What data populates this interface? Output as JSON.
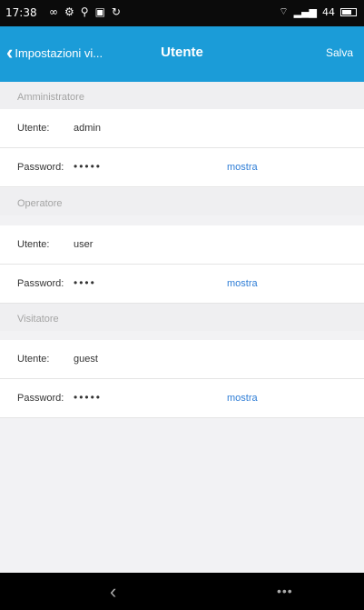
{
  "status_bar": {
    "time": "17:38",
    "signal_text": "44"
  },
  "navbar": {
    "back_label": "Impostazioni vi...",
    "title": "Utente",
    "save_label": "Salva"
  },
  "sections": [
    {
      "header": "Amministratore",
      "user_label": "Utente:",
      "user_value": "admin",
      "password_label": "Password:",
      "password_mask": "•••••",
      "show_label": "mostra"
    },
    {
      "header": "Operatore",
      "user_label": "Utente:",
      "user_value": "user",
      "password_label": "Password:",
      "password_mask": "••••",
      "show_label": "mostra"
    },
    {
      "header": "Visitatore",
      "user_label": "Utente:",
      "user_value": "guest",
      "password_label": "Password:",
      "password_mask": "•••••",
      "show_label": "mostra"
    }
  ],
  "colors": {
    "accent": "#1b9cd8",
    "link": "#2e7dd6",
    "background": "#f2f2f4"
  }
}
